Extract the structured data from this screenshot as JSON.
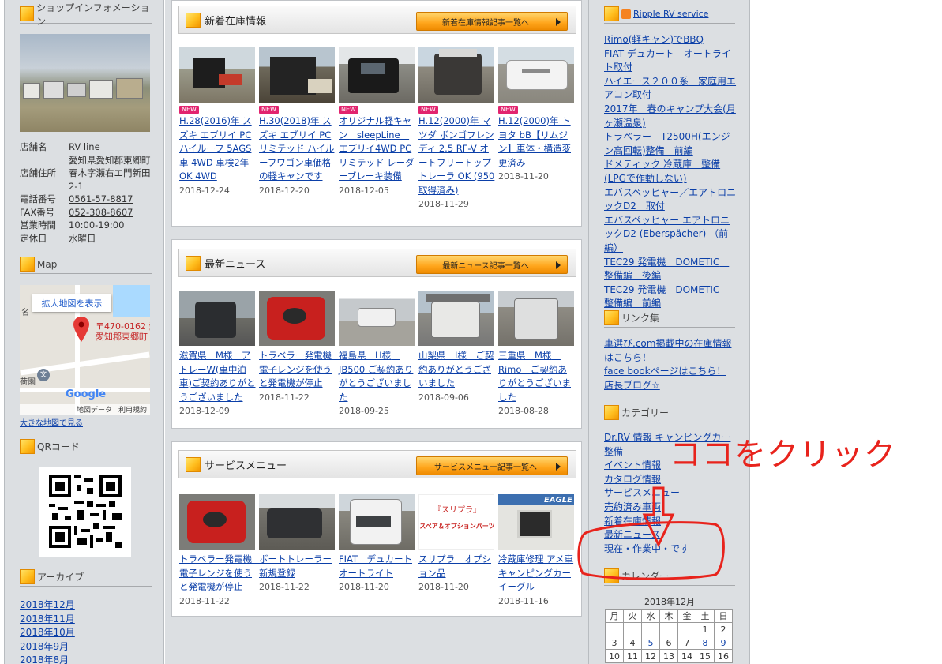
{
  "left": {
    "shop_heading": "ショップインフォメーション",
    "info": [
      {
        "key": "店舗名",
        "value": "RV line"
      },
      {
        "key": "店舗住所",
        "value": "愛知県愛知郡東郷町春木字瀬右エ門新田2-1"
      },
      {
        "key": "電話番号",
        "value": "0561-57-8817",
        "link": true
      },
      {
        "key": "FAX番号",
        "value": "052-308-8607",
        "link": true
      },
      {
        "key": "営業時間",
        "value": "10:00-19:00"
      },
      {
        "key": "定休日",
        "value": "水曜日"
      }
    ],
    "map_heading": "Map",
    "map_enlarge": "拡大地図を表示",
    "map_label_1": "〒470-0162 愛",
    "map_label_2": "愛知郡東郷町",
    "map_side_1": "名",
    "map_side_2": "荷園",
    "map_logo": "Google",
    "map_data": "地図データ",
    "map_terms": "利用規約",
    "map_link": "大きな地図で見る",
    "qr_heading": "QRコード",
    "archive_heading": "アーカイブ",
    "archives": [
      "2018年12月",
      "2018年11月",
      "2018年10月",
      "2018年9月",
      "2018年8月"
    ]
  },
  "panels": [
    {
      "title": "新着在庫情報",
      "button": "新着在庫情報記事一覧へ",
      "items": [
        {
          "new": "NEW",
          "title": "H.28(2016)年 スズキ エブリイ PC ハイルーフ 5AGS車 4WD 車検2年OK 4WD",
          "date": "2018-12-24"
        },
        {
          "new": "NEW",
          "title": "H.30(2018)年 スズキ エブリイ PC リミテッド ハイルーフワゴン車価格の軽キャンです",
          "date": "2018-12-20"
        },
        {
          "new": "NEW",
          "title": "オリジナル軽キャン　sleepLine　エブリイ4WD PCリミテッド レーダーブレーキ装備",
          "date": "2018-12-05"
        },
        {
          "new": "NEW",
          "title": "H.12(2000)年 マツダ ボンゴフレンディ 2.5 RF-V オートフリートップ トレーラ OK (950取得済み)",
          "date": "2018-11-29"
        },
        {
          "new": "NEW",
          "title": "H.12(2000)年 トヨタ bB【リムジン】車体・構造変更済み",
          "date": "2018-11-20"
        }
      ]
    },
    {
      "title": "最新ニュース",
      "button": "最新ニュース記事一覧へ",
      "items": [
        {
          "title": "滋賀県　M様　アトレーW(車中泊車)ご契約ありがとうございました",
          "date": "2018-12-09"
        },
        {
          "title": "トラベラー発電機　電子レンジを使うと発電機が停止",
          "date": "2018-11-22"
        },
        {
          "title": "福島県　H様　JB500 ご契約ありがとうございました",
          "date": "2018-09-25"
        },
        {
          "title": "山梨県　I様　ご契約ありがとうございました",
          "date": "2018-09-06"
        },
        {
          "title": "三重県　M様　Rimo　ご契約ありがとうございました",
          "date": "2018-08-28"
        }
      ]
    },
    {
      "title": "サービスメニュー",
      "button": "サービスメニュー記事一覧へ",
      "items": [
        {
          "title": "トラベラー発電機　電子レンジを使うと発電機が停止",
          "date": "2018-11-22"
        },
        {
          "title": "ボートトレーラー新規登録",
          "date": "2018-11-22"
        },
        {
          "title": "FIAT　デュカート オートライト",
          "date": "2018-11-20"
        },
        {
          "title": "スリプラ　オプション品",
          "date": "2018-11-20",
          "thumb_text_1": "『スリプラ』",
          "thumb_text_2": "スペア＆オプションパーツ"
        },
        {
          "title": "冷蔵庫修理 アメ車 キャンピングカー イーグル",
          "date": "2018-11-16",
          "thumb_text_1": "EAGLE"
        }
      ]
    }
  ],
  "right": {
    "rss_heading": "Ripple RV service",
    "rss_items": [
      "Rimo(軽キャン)でBBQ",
      "FIAT デュカート　オートライト取付",
      "ハイエース２００系　家庭用エアコン取付",
      "2017年　春のキャンプ大会(月ヶ瀬温泉)",
      "トラベラー　T2500H(エンジン高回転)整備　前編",
      "ドメティック 冷蔵庫　整備(LPGで作動しない)",
      "エバスペッヒャー／エアトロニックD2　取付",
      "エバスペッヒャー エアトロニックD2 (Eberspächer) （前編）",
      "TEC29 発電機　DOMETIC　整備編　後編",
      "TEC29 発電機　DOMETIC　整備編　前編"
    ],
    "links_heading": "リンク集",
    "links": [
      "車選び.com掲載中の在庫情報はこちら！",
      "face bookページはこちら！",
      "店長ブログ☆"
    ],
    "category_heading": "カテゴリー",
    "categories": [
      "Dr.RV 情報 キャンピングカー整備",
      "イベント情報",
      "カタログ情報",
      "サービスメニュー",
      "売約済み車両",
      "新着在庫情報",
      "最新ニュース",
      "現在・作業中・です"
    ],
    "calendar_heading": "カレンダー",
    "calendar_month": "2018年12月",
    "weekdays": [
      "月",
      "火",
      "水",
      "木",
      "金",
      "土",
      "日"
    ],
    "weeks": [
      [
        "",
        "",
        "",
        "",
        "",
        "1",
        "2"
      ],
      [
        "3",
        "4",
        "5",
        "6",
        "7",
        "8",
        "9"
      ],
      [
        "10",
        "11",
        "12",
        "13",
        "14",
        "15",
        "16"
      ]
    ],
    "calendar_linked_days": [
      "5",
      "8",
      "9"
    ]
  },
  "annotation": {
    "text": "ココをクリック",
    "color": "#e8231c"
  }
}
